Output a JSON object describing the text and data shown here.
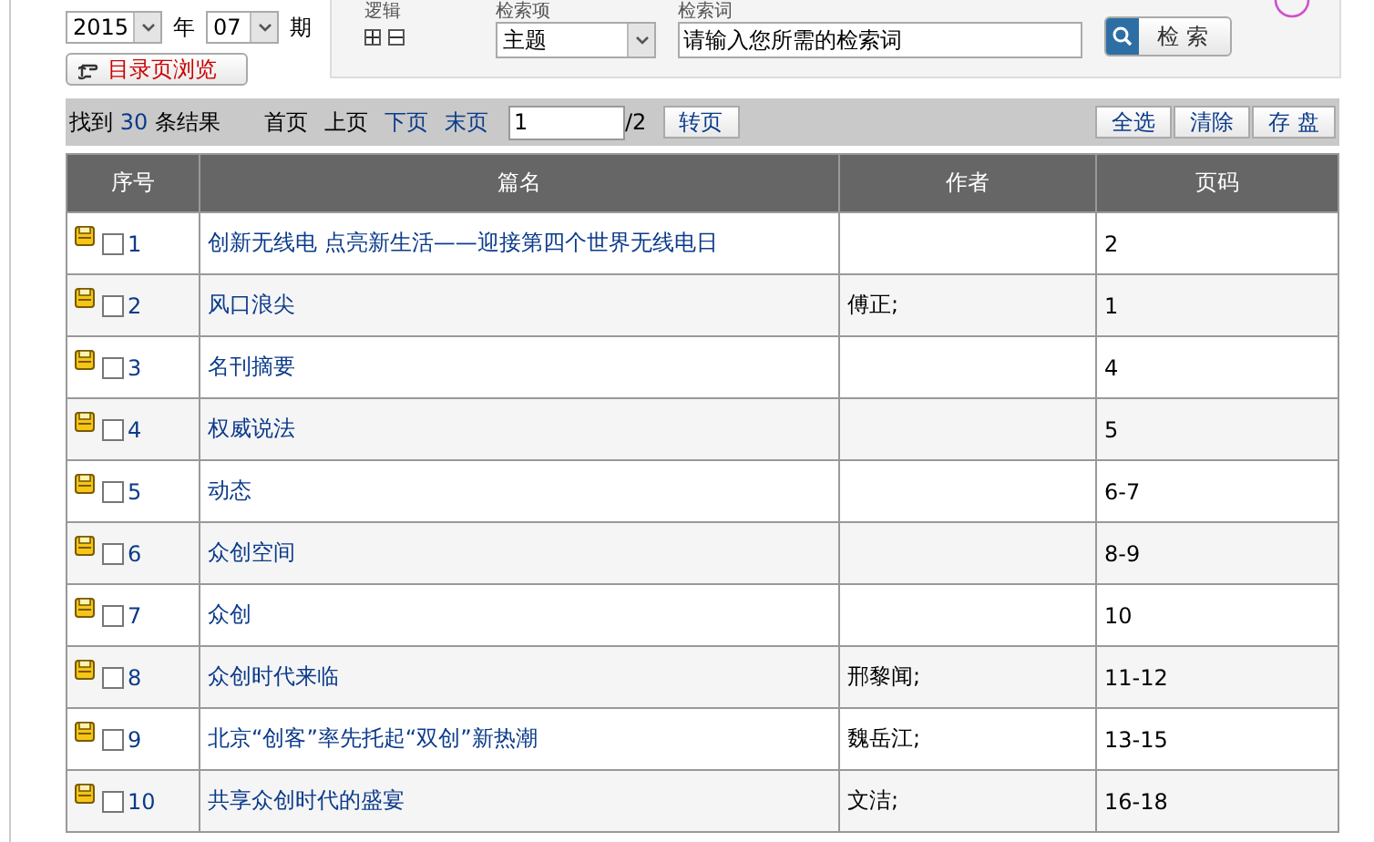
{
  "issue": {
    "year": "2015",
    "year_label": "年",
    "number": "07",
    "number_label": "期",
    "browse_button": "目录页浏览"
  },
  "search": {
    "logic_label": "逻辑",
    "field_label": "检索项",
    "term_label": "检索词",
    "field_value": "主题",
    "placeholder": "请输入您所需的检索词",
    "search_button": "检 索"
  },
  "results": {
    "found_prefix": "找到",
    "count": "30",
    "found_suffix": "条结果",
    "pager": [
      {
        "label": "首页",
        "enabled": false
      },
      {
        "label": "上页",
        "enabled": false
      },
      {
        "label": "下页",
        "enabled": true
      },
      {
        "label": "末页",
        "enabled": true
      }
    ],
    "page_value": "1",
    "page_total": "/2",
    "goto_button": "转页",
    "actions": [
      "全选",
      "清除",
      "存 盘"
    ]
  },
  "table": {
    "columns": [
      "序号",
      "篇名",
      "作者",
      "页码"
    ],
    "rows": [
      {
        "no": "1",
        "title": "创新无线电 点亮新生活——迎接第四个世界无线电日",
        "author": "",
        "pages": "2",
        "checked": false
      },
      {
        "no": "2",
        "title": "风口浪尖",
        "author": "傅正;",
        "pages": "1",
        "checked": false
      },
      {
        "no": "3",
        "title": "名刊摘要",
        "author": "",
        "pages": "4",
        "checked": false
      },
      {
        "no": "4",
        "title": "权威说法",
        "author": "",
        "pages": "5",
        "checked": false
      },
      {
        "no": "5",
        "title": "动态",
        "author": "",
        "pages": "6-7",
        "checked": false
      },
      {
        "no": "6",
        "title": "众创空间",
        "author": "",
        "pages": "8-9",
        "checked": false
      },
      {
        "no": "7",
        "title": "众创",
        "author": "",
        "pages": "10",
        "checked": false
      },
      {
        "no": "8",
        "title": "众创时代来临",
        "author": "邢黎闻;",
        "pages": "11-12",
        "checked": false
      },
      {
        "no": "9",
        "title": "北京“创客”率先托起“双创”新热潮",
        "author": "魏岳江;",
        "pages": "13-15",
        "checked": false
      },
      {
        "no": "10",
        "title": "共享众创时代的盛宴",
        "author": "文洁;",
        "pages": "16-18",
        "checked": false
      }
    ]
  }
}
